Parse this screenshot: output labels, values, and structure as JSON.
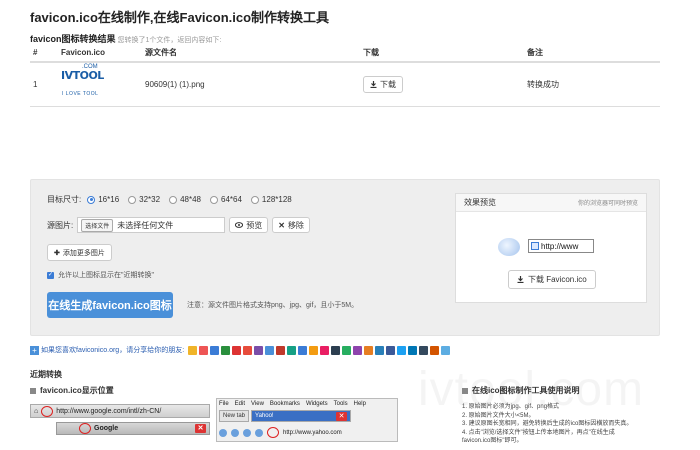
{
  "page_title": "favicon.ico在线制作,在线Favicon.ico制作转换工具",
  "result": {
    "heading": "favicon图标转换结果",
    "sub": "您转换了1个文件，返回内容如下:",
    "columns": [
      "#",
      "Favicon.ico",
      "源文件名",
      "下载",
      "备注"
    ],
    "rows": [
      {
        "index": "1",
        "filename": "90609(1) (1).png",
        "download_label": "下载",
        "note": "转换成功"
      }
    ],
    "logo_text": "IVTOOL",
    "logo_small": ".COM",
    "logo_tagline": "I LOVE TOOL"
  },
  "form": {
    "size_label": "目标尺寸:",
    "sizes": [
      "16*16",
      "32*32",
      "48*48",
      "64*64",
      "128*128"
    ],
    "selected_size": "16*16",
    "source_label": "源图片:",
    "choose_file": "选择文件",
    "no_file": "未选择任何文件",
    "preview_btn": "预览",
    "remove_btn": "移除",
    "add_more": "添加更多图片",
    "checkbox_label": "允许以上图标显示在\"近期转换\"",
    "generate_btn": "在线生成favicon.ico图标",
    "note": "注意：源文件图片格式支持png、jpg、gif，且小于5M。"
  },
  "preview": {
    "title": "效果预览",
    "hint": "你的浏览器可同时预览",
    "url": "http://www",
    "download": "下载 Favicon.ico"
  },
  "share": {
    "text": "如果您喜欢faviconico.org，请分享给你的朋友:",
    "colors": [
      "#f0b429",
      "#e55",
      "#3b7cd6",
      "#2a8f3d",
      "#d33",
      "#e74c3c",
      "#7b4ea8",
      "#4a90d9",
      "#c0392b",
      "#16a085",
      "#3b7cd6",
      "#f39c12",
      "#e91e63",
      "#2c3e50",
      "#27ae60",
      "#8e44ad",
      "#e67e22",
      "#2980b9",
      "#3b5998",
      "#1da1f2",
      "#0077b5",
      "#34495e",
      "#d35400",
      "#5dade2"
    ]
  },
  "recent_label": "近期转换",
  "display_position": {
    "heading": "favicon.ico显示位置",
    "url_ie": "http://www.google.com/intl/zh-CN/",
    "google_tab": "Google",
    "menu": [
      "File",
      "Edit",
      "View",
      "Bookmarks",
      "Widgets",
      "Tools",
      "Help"
    ],
    "new_tab": "New tab",
    "yahoo_tab": "Yahoo!",
    "yahoo_url": "http://www.yahoo.com"
  },
  "help": {
    "heading": "在线ico图标制作工具使用说明",
    "items": [
      "1. 原始图片必须为jpg、gif、png格式",
      "2. 原始图片文件大小<5M。",
      "3. 建议原图长宽相同，避免转换后生成的ico图标因横放而失真。",
      "4. 点击\"浏览/选择文件\"按钮上传本地图片，再点\"在线生成",
      "favicon.ico图标\"即可。"
    ]
  },
  "watermark": "ivtool.com"
}
